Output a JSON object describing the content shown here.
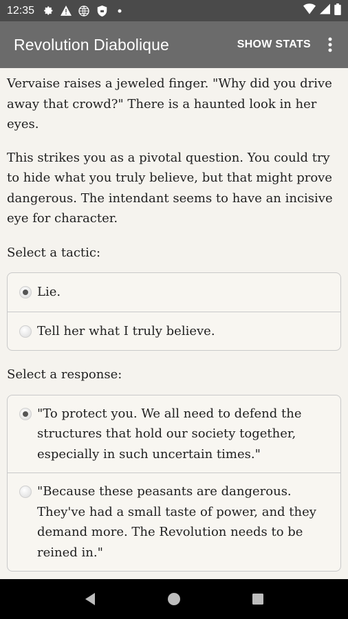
{
  "status_bar": {
    "time": "12:35",
    "left_icons": [
      "gear-icon",
      "warning-icon",
      "globe-icon",
      "shield-icon",
      "dot-icon"
    ],
    "right_icons": [
      "wifi-icon",
      "signal-icon",
      "battery-icon"
    ]
  },
  "app_bar": {
    "title": "Revolution Diabolique",
    "action_label": "SHOW STATS",
    "overflow_icon": "more-vert-icon"
  },
  "content": {
    "paragraphs": [
      "Vervaise raises a jeweled finger. \"Why did you drive away that crowd?\" There is a haunted look in her eyes.",
      "This strikes you as a pivotal question. You could try to hide what you truly believe, but that might prove dangerous. The intendant seems to have an incisive eye for character."
    ],
    "tactic": {
      "label": "Select a tactic:",
      "options": [
        {
          "text": "Lie.",
          "selected": true
        },
        {
          "text": "Tell her what I truly believe.",
          "selected": false
        }
      ]
    },
    "response": {
      "label": "Select a response:",
      "options": [
        {
          "text": "\"To protect you. We all need to defend the structures that hold our society together, especially in such uncertain times.\"",
          "selected": true
        },
        {
          "text": "\"Because these peasants are dangerous. They've had a small taste of power, and they demand more. The Revolution needs to be reined in.\"",
          "selected": false
        }
      ]
    }
  },
  "nav_bar": {
    "icons": [
      "back-icon",
      "home-icon",
      "recents-icon"
    ]
  },
  "colors": {
    "status_bar_bg": "#4a4a4a",
    "app_bar_bg": "#6b6b6b",
    "page_bg": "#f5f3ee",
    "nav_bar_bg": "#000000"
  }
}
